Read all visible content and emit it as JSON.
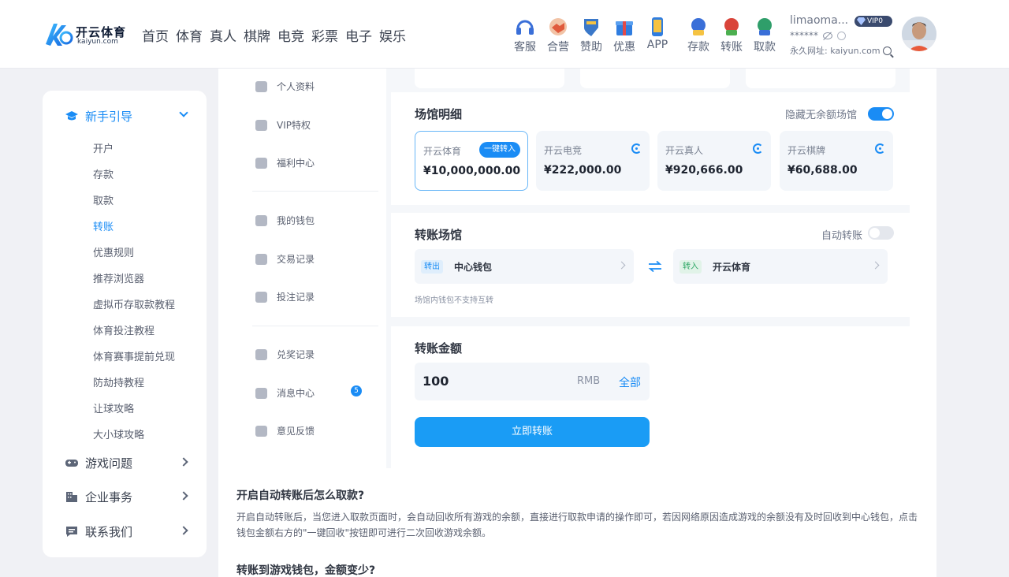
{
  "header": {
    "logo_cn": "开云体育",
    "logo_en": "kaiyun.com",
    "nav": [
      "首页",
      "体育",
      "真人",
      "棋牌",
      "电竞",
      "彩票",
      "电子",
      "娱乐"
    ],
    "tools": [
      {
        "label": "客服",
        "icon": "headset-icon",
        "color": "#3a6fd8"
      },
      {
        "label": "合营",
        "icon": "handshake-icon",
        "color": "#e05a3c"
      },
      {
        "label": "赞助",
        "icon": "trophy-shield-icon",
        "color": "#3a78c9"
      },
      {
        "label": "优惠",
        "icon": "gift-icon",
        "color": "#2f7de0"
      },
      {
        "label": "APP",
        "icon": "phone-icon",
        "color": "#2f7de0"
      },
      {
        "label": "存款",
        "icon": "deposit-icon",
        "color": "#3a6fd8"
      },
      {
        "label": "转账",
        "icon": "transfer-icon",
        "color": "#d9443a"
      },
      {
        "label": "取款",
        "icon": "withdraw-icon",
        "color": "#2f9e6a"
      }
    ],
    "user": {
      "name": "limaoma...",
      "vip": "VIP0",
      "masked": "******",
      "url_label": "永久网址: kaiyun.com"
    }
  },
  "sidebar": {
    "groups": [
      {
        "label": "新手引导",
        "icon": "graduation-cap-icon",
        "expanded": true
      },
      {
        "label": "游戏问题",
        "icon": "gamepad-icon",
        "expanded": false
      },
      {
        "label": "企业事务",
        "icon": "building-icon",
        "expanded": false
      },
      {
        "label": "联系我们",
        "icon": "chat-icon",
        "expanded": false
      }
    ],
    "sub_items": [
      "开户",
      "存款",
      "取款",
      "转账",
      "优惠规则",
      "推荐浏览器",
      "虚拟币存取款教程",
      "体育投注教程",
      "体育赛事提前兑现",
      "防劫持教程",
      "让球攻略",
      "大小球攻略"
    ],
    "active_sub": "转账"
  },
  "menu": {
    "items": [
      "个人资料",
      "VIP特权",
      "福利中心",
      "我的钱包",
      "交易记录",
      "投注记录",
      "兑奖记录",
      "消息中心",
      "意见反馈"
    ],
    "message_count": "5"
  },
  "venue_detail": {
    "title": "场馆明细",
    "hide_toggle_label": "隐藏无余额场馆",
    "hide_toggle_on": true,
    "one_key_label": "一键转入",
    "wallets": [
      {
        "name": "开云体育",
        "amount": "¥10,000,000.00"
      },
      {
        "name": "开云电竞",
        "amount": "¥222,000.00"
      },
      {
        "name": "开云真人",
        "amount": "¥920,666.00"
      },
      {
        "name": "开云棋牌",
        "amount": "¥60,688.00"
      }
    ]
  },
  "transfer_venue": {
    "title": "转账场馆",
    "auto_label": "自动转账",
    "auto_on": false,
    "from_tag": "转出",
    "from_name": "中心钱包",
    "to_tag": "转入",
    "to_name": "开云体育",
    "note": "场馆内钱包不支持互转"
  },
  "amount": {
    "title": "转账金额",
    "value": "100",
    "unit": "RMB",
    "all_label": "全部",
    "submit_label": "立即转账"
  },
  "faq": [
    {
      "q": "开启自动转账后怎么取款?",
      "a": "开启自动转账后，当您进入取款页面时，会自动回收所有游戏的余额，直接进行取款申请的操作即可，若因网络原因造成游戏的余额没有及时回收到中心钱包，点击钱包金额右方的\"一键回收\"按钮即可进行二次回收游戏余额。"
    },
    {
      "q": "转账到游戏钱包，金额变少?",
      "a": ""
    }
  ]
}
